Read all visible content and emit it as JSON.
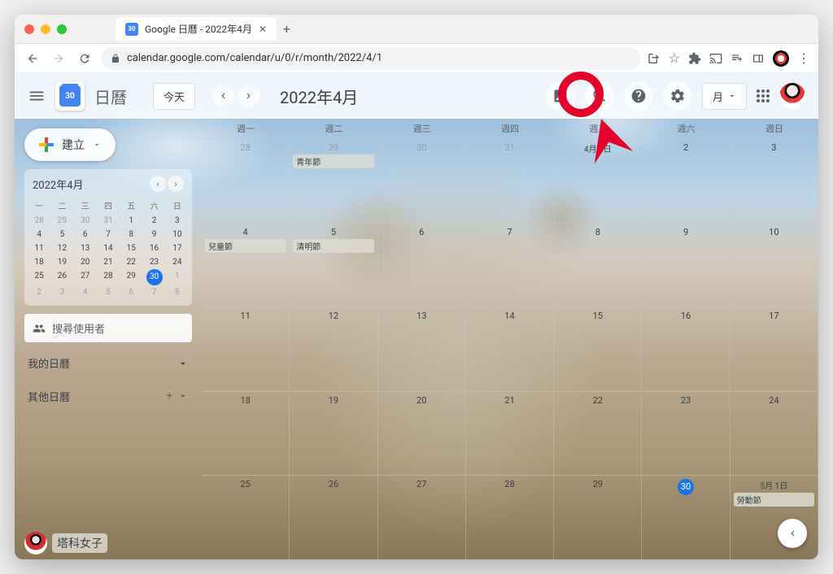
{
  "browser": {
    "tab_title": "Google 日曆 - 2022年4月",
    "url": "calendar.google.com/calendar/u/0/r/month/2022/4/1"
  },
  "header": {
    "app_name": "日曆",
    "logo_day": "30",
    "today_btn": "今天",
    "month_title": "2022年4月",
    "view_label": "月"
  },
  "sidebar": {
    "create_label": "建立",
    "mini_month": "2022年4月",
    "dow": [
      "一",
      "二",
      "三",
      "四",
      "五",
      "六",
      "日"
    ],
    "mini_days": [
      {
        "n": "28",
        "o": true
      },
      {
        "n": "29",
        "o": true
      },
      {
        "n": "30",
        "o": true
      },
      {
        "n": "31",
        "o": true
      },
      {
        "n": "1"
      },
      {
        "n": "2"
      },
      {
        "n": "3"
      },
      {
        "n": "4"
      },
      {
        "n": "5"
      },
      {
        "n": "6"
      },
      {
        "n": "7"
      },
      {
        "n": "8"
      },
      {
        "n": "9"
      },
      {
        "n": "10"
      },
      {
        "n": "11"
      },
      {
        "n": "12"
      },
      {
        "n": "13"
      },
      {
        "n": "14"
      },
      {
        "n": "15"
      },
      {
        "n": "16"
      },
      {
        "n": "17"
      },
      {
        "n": "18"
      },
      {
        "n": "19"
      },
      {
        "n": "20"
      },
      {
        "n": "21"
      },
      {
        "n": "22"
      },
      {
        "n": "23"
      },
      {
        "n": "24"
      },
      {
        "n": "25"
      },
      {
        "n": "26"
      },
      {
        "n": "27"
      },
      {
        "n": "28"
      },
      {
        "n": "29"
      },
      {
        "n": "30",
        "t": true
      },
      {
        "n": "1",
        "o": true
      },
      {
        "n": "2",
        "o": true
      },
      {
        "n": "3",
        "o": true
      },
      {
        "n": "4",
        "o": true
      },
      {
        "n": "5",
        "o": true
      },
      {
        "n": "6",
        "o": true
      },
      {
        "n": "7",
        "o": true
      },
      {
        "n": "8",
        "o": true
      }
    ],
    "search_placeholder": "搜尋使用者",
    "my_calendars": "我的日曆",
    "other_calendars": "其他日曆"
  },
  "grid": {
    "dow": [
      "週一",
      "週二",
      "週三",
      "週四",
      "週五",
      "週六",
      "週日"
    ],
    "weeks": [
      [
        {
          "n": "28",
          "o": true
        },
        {
          "n": "29",
          "o": true,
          "ev": [
            "青年節"
          ]
        },
        {
          "n": "30",
          "o": true
        },
        {
          "n": "31",
          "o": true
        },
        {
          "n": "4月 1日",
          "ml": true
        },
        {
          "n": "2"
        },
        {
          "n": "3"
        }
      ],
      [
        {
          "n": "4",
          "ev": [
            "兒童節"
          ]
        },
        {
          "n": "5",
          "ev": [
            "清明節"
          ]
        },
        {
          "n": "6"
        },
        {
          "n": "7"
        },
        {
          "n": "8"
        },
        {
          "n": "9"
        },
        {
          "n": "10"
        }
      ],
      [
        {
          "n": "11"
        },
        {
          "n": "12"
        },
        {
          "n": "13"
        },
        {
          "n": "14"
        },
        {
          "n": "15"
        },
        {
          "n": "16"
        },
        {
          "n": "17"
        }
      ],
      [
        {
          "n": "18"
        },
        {
          "n": "19"
        },
        {
          "n": "20"
        },
        {
          "n": "21"
        },
        {
          "n": "22"
        },
        {
          "n": "23"
        },
        {
          "n": "24"
        }
      ],
      [
        {
          "n": "25"
        },
        {
          "n": "26"
        },
        {
          "n": "27"
        },
        {
          "n": "28"
        },
        {
          "n": "29"
        },
        {
          "n": "30",
          "t": true
        },
        {
          "n": "5月 1日",
          "o": true,
          "ml": true,
          "ev": [
            "勞動節"
          ]
        }
      ]
    ]
  },
  "watermark": "塔科女子"
}
